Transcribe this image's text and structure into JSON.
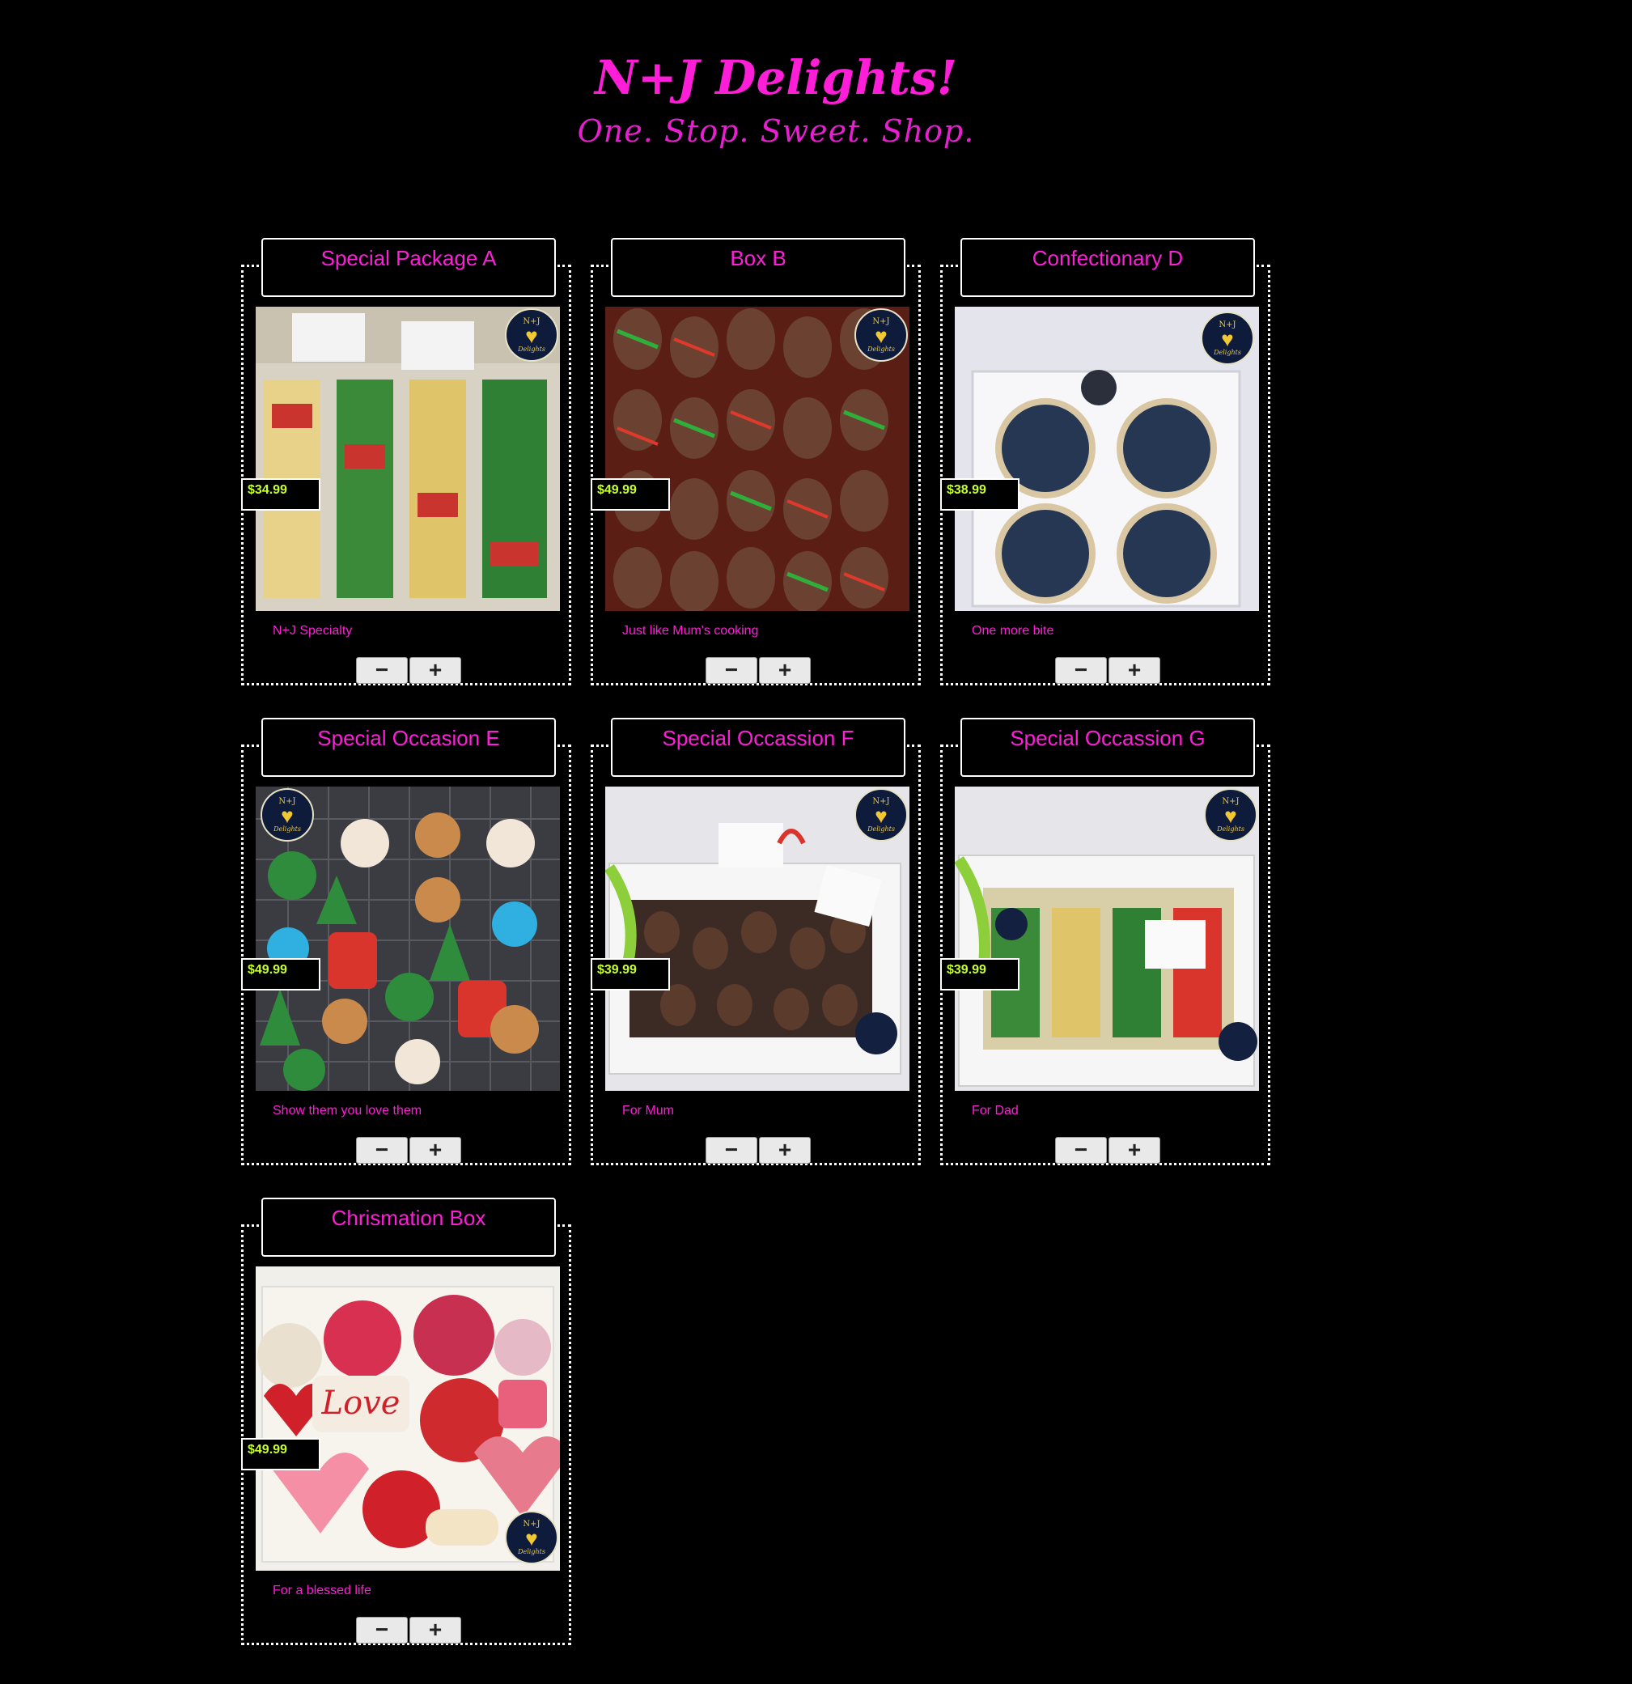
{
  "site": {
    "title": "N+J Delights!",
    "tagline": "One. Stop. Sweet. Shop."
  },
  "badge": {
    "top": "N+J",
    "bottom": "Delights"
  },
  "controls": {
    "minus": "−",
    "plus": "+"
  },
  "products": [
    {
      "title": "Special Package A",
      "price": "$34.99",
      "description": "N+J Specialty"
    },
    {
      "title": "Box B",
      "price": "$49.99",
      "description": "Just like Mum's cooking"
    },
    {
      "title": "Confectionary D",
      "price": "$38.99",
      "description": "One more bite"
    },
    {
      "title": "Special Occasion E",
      "price": "$49.99",
      "description": "Show them you love them"
    },
    {
      "title": "Special Occassion F",
      "price": "$39.99",
      "description": "For Mum"
    },
    {
      "title": "Special Occassion G",
      "price": "$39.99",
      "description": "For Dad"
    },
    {
      "title": "Chrismation Box",
      "price": "$49.99",
      "description": "For a blessed life"
    }
  ],
  "colors": {
    "accent": "#ff1ed8",
    "price": "#c6ff2b",
    "background": "#000000"
  }
}
